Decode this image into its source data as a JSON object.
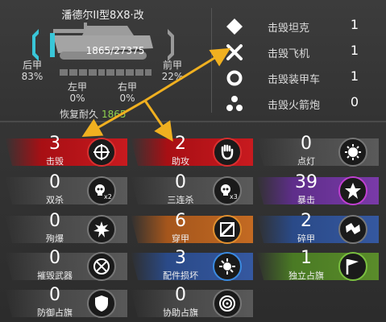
{
  "tank": {
    "name": "潘德尔II型8X8·改",
    "hp": "1865/27375",
    "front_armor_label": "前甲",
    "front_armor_value": "22%",
    "rear_armor_label": "后甲",
    "rear_armor_value": "83%",
    "left_armor_label": "左甲",
    "left_armor_value": "0%",
    "right_armor_label": "右甲",
    "right_armor_value": "0%",
    "repair_label": "恢复耐久",
    "repair_value": "1865"
  },
  "kills": [
    {
      "icon": "diamond-icon",
      "label": "击毁坦克",
      "value": "1"
    },
    {
      "icon": "x-cross-icon",
      "label": "击毁飞机",
      "value": "1"
    },
    {
      "icon": "ring-icon",
      "label": "击毁装甲车",
      "value": "1"
    },
    {
      "icon": "triangle-dots-icon",
      "label": "击毁火箭炮",
      "value": "0"
    }
  ],
  "stats": [
    {
      "value": "3",
      "label": "击毁",
      "theme": "red",
      "icon": "target-hit-icon"
    },
    {
      "value": "2",
      "label": "助攻",
      "theme": "red",
      "icon": "fist-icon"
    },
    {
      "value": "0",
      "label": "点灯",
      "theme": "grey",
      "icon": "spotting-icon"
    },
    {
      "value": "0",
      "label": "双杀",
      "theme": "grey",
      "icon": "skull-x2-icon"
    },
    {
      "value": "0",
      "label": "三连杀",
      "theme": "grey",
      "icon": "skull-x3-icon"
    },
    {
      "value": "39",
      "label": "暴击",
      "theme": "purple",
      "icon": "critical-hit-icon"
    },
    {
      "value": "0",
      "label": "殉爆",
      "theme": "grey",
      "icon": "explosion-icon"
    },
    {
      "value": "6",
      "label": "穿甲",
      "theme": "orange",
      "icon": "penetration-icon"
    },
    {
      "value": "2",
      "label": "碎甲",
      "theme": "blue",
      "icon": "armor-break-icon"
    },
    {
      "value": "0",
      "label": "摧毁武器",
      "theme": "grey",
      "icon": "weapon-destroy-icon"
    },
    {
      "value": "3",
      "label": "配件损坏",
      "theme": "blue",
      "icon": "module-damage-icon"
    },
    {
      "value": "1",
      "label": "独立占旗",
      "theme": "green",
      "icon": "flag-capture-icon"
    },
    {
      "value": "0",
      "label": "防御占旗",
      "theme": "grey",
      "icon": "shield-icon"
    },
    {
      "value": "0",
      "label": "协助占旗",
      "theme": "grey",
      "icon": "assist-capture-icon"
    }
  ],
  "colors": {
    "red": "#c81a1f",
    "purple": "#7a3aa8",
    "orange": "#c36a22",
    "blue": "#3558a0",
    "green": "#5a8c2a",
    "arrow": "#f0b020",
    "repair_value": "#8fd14f"
  }
}
